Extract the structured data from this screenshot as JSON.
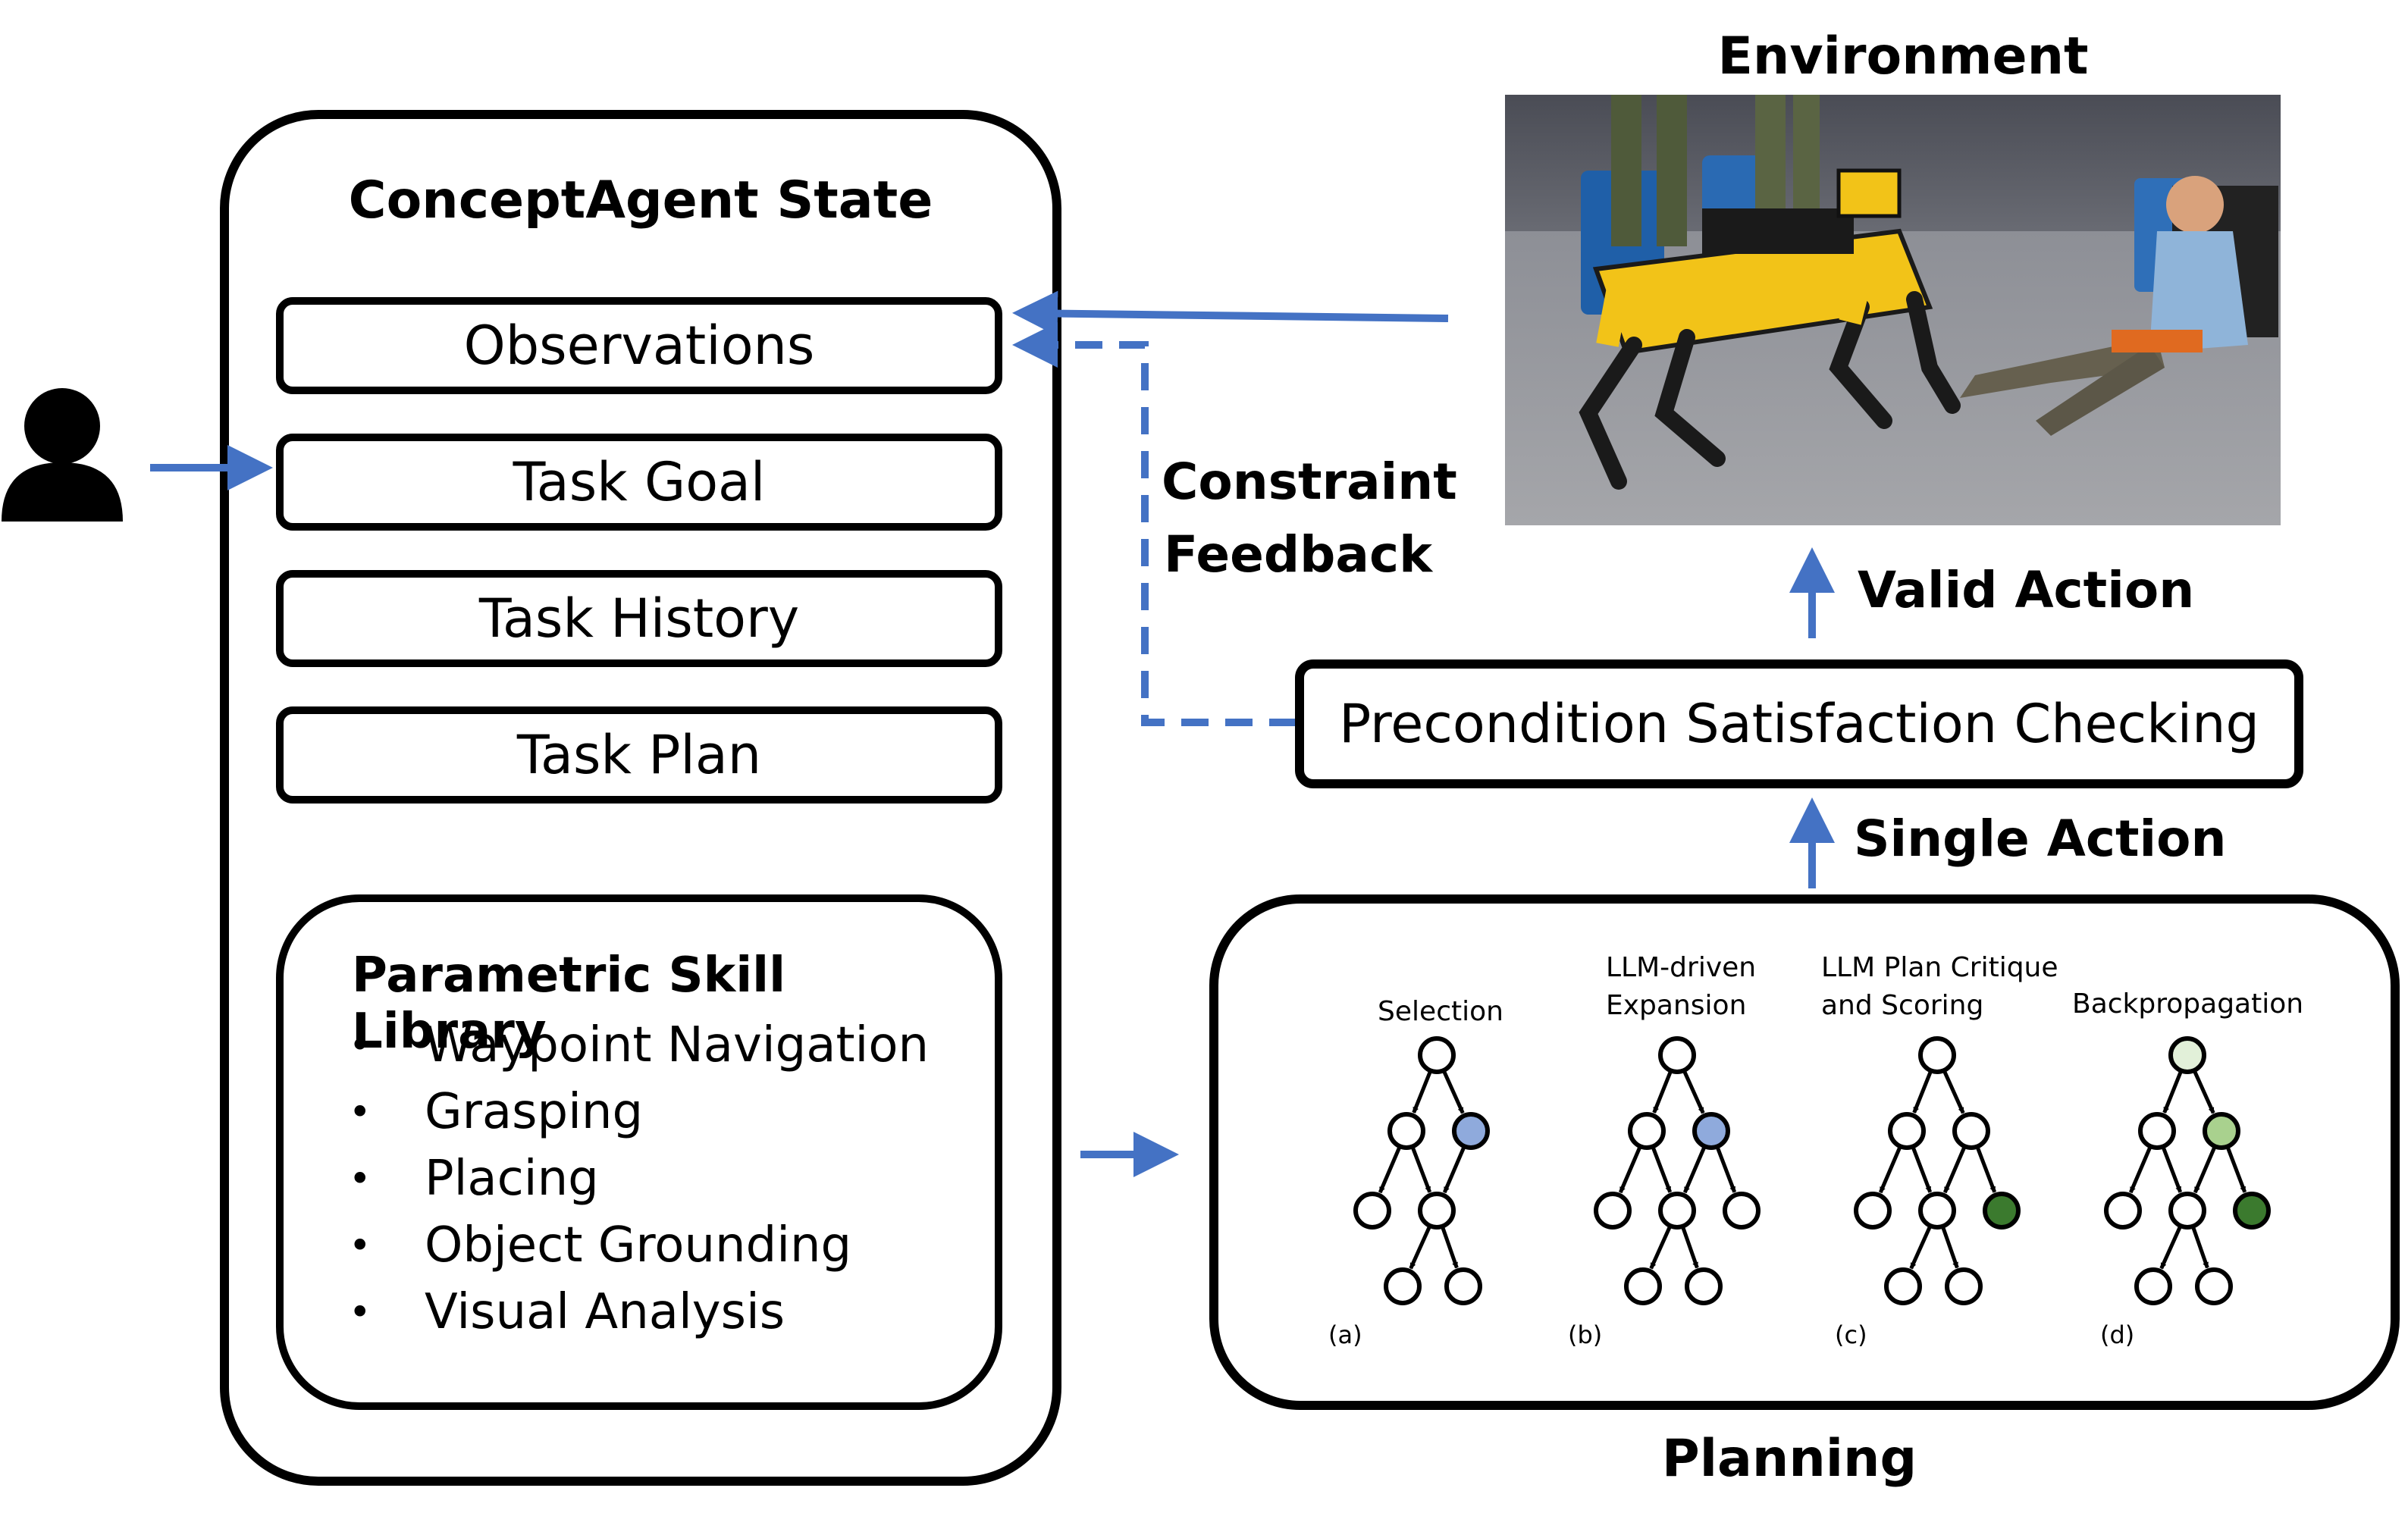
{
  "state_panel": {
    "title": "ConceptAgent State",
    "boxes": [
      {
        "label": "Observations"
      },
      {
        "label": "Task Goal"
      },
      {
        "label": "Task History"
      },
      {
        "label": "Task Plan"
      }
    ],
    "skill_library": {
      "title": "Parametric Skill Library",
      "items": [
        "Waypoint Navigation",
        "Grasping",
        "Placing",
        "Object Grounding",
        "Visual Analysis"
      ]
    }
  },
  "user": {
    "icon": "person-icon"
  },
  "environment": {
    "title": "Environment",
    "image_description": "quadruped robot next to a seated mannequin in an indoor test area"
  },
  "labels": {
    "constraint_feedback_line1": "Constraint",
    "constraint_feedback_line2": "Feedback",
    "valid_action": "Valid Action",
    "single_action": "Single Action",
    "precondition": "Precondition Satisfaction Checking",
    "planning": "Planning"
  },
  "planning_panel": {
    "stages": [
      {
        "title_line1": "Selection",
        "title_line2": "",
        "tag": "(a)"
      },
      {
        "title_line1": "LLM-driven",
        "title_line2": "Expansion",
        "tag": "(b)"
      },
      {
        "title_line1": "LLM Plan Critique",
        "title_line2": "and Scoring",
        "tag": "(c)"
      },
      {
        "title_line1": "Backpropagation",
        "title_line2": "",
        "tag": "(d)"
      }
    ]
  },
  "colors": {
    "arrow_blue": "#4472C4",
    "node_selected_blue": "#8FAADC",
    "node_scored_green": "#3B7A2E",
    "node_backprop_light": "#E2F0D9",
    "node_backprop_mid": "#A9D18E"
  }
}
